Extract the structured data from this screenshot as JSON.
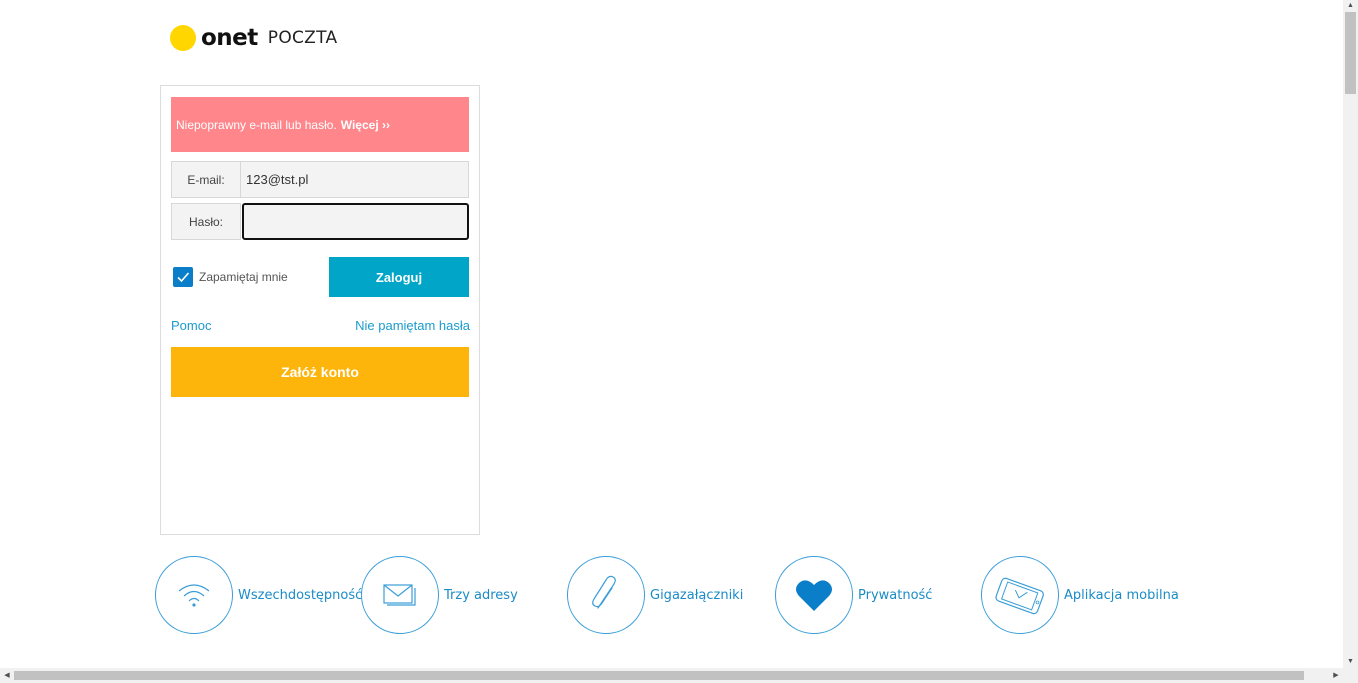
{
  "header": {
    "logo_word": "onet",
    "logo_sub": "POCZTA"
  },
  "login": {
    "error_text": "Niepoprawny e-mail lub hasło.",
    "error_more": "Więcej ››",
    "email_label": "E-mail:",
    "email_value": "123@tst.pl",
    "password_label": "Hasło:",
    "password_value": "",
    "remember_label": "Zapamiętaj mnie",
    "remember_checked": true,
    "login_button": "Zaloguj",
    "help_link": "Pomoc",
    "forgot_link": "Nie pamiętam hasła",
    "create_account_button": "Załóż konto"
  },
  "features": [
    {
      "label": "Wszechdostępność",
      "icon": "wifi-icon"
    },
    {
      "label": "Trzy adresy",
      "icon": "envelope-icon"
    },
    {
      "label": "Gigazałączniki",
      "icon": "paperclip-icon"
    },
    {
      "label": "Prywatność",
      "icon": "heart-icon"
    },
    {
      "label": "Aplikacja mobilna",
      "icon": "mobile-app-icon"
    }
  ],
  "colors": {
    "logo_dot": "#ffd600",
    "error_bg": "#ff868b",
    "login_button": "#00a5c8",
    "create_button": "#fdb50c",
    "link": "#1a9ccc",
    "feature_accent": "#3a9dd8"
  }
}
